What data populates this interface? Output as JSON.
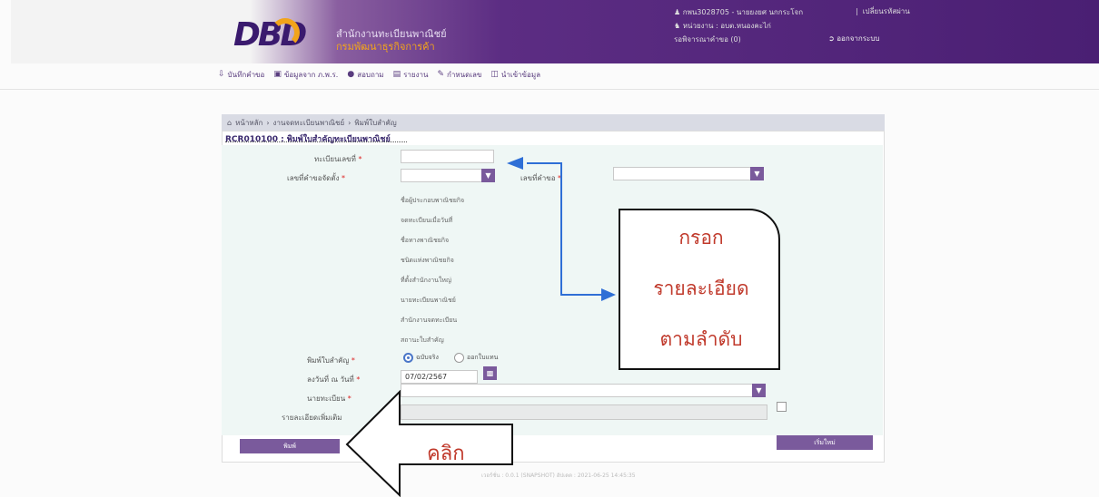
{
  "header": {
    "logo_text": "DBD",
    "dept_line1": "สำนักงานทะเบียนพาณิชย์",
    "dept_line2": "กรมพัฒนาธุรกิจการค้า",
    "user_line": "กพน3028705 - นายยงยศ นกกระโจก",
    "unit_line": "หน่วยงาน : อบต.หนองคะไก่",
    "pending_line": "รอพิจารณาคำขอ (0)",
    "change_password": "เปลี่ยนรหัสผ่าน",
    "separator": "|",
    "logout": "ออกจากระบบ"
  },
  "menu": {
    "items": [
      {
        "icon": "save-icon",
        "label": "บันทึกคำขอ"
      },
      {
        "icon": "monitor-icon",
        "label": "ข้อมูลจาก ภ.พ.ร."
      },
      {
        "icon": "chat-icon",
        "label": "สอบถาม"
      },
      {
        "icon": "report-icon",
        "label": "รายงาน"
      },
      {
        "icon": "edit-icon",
        "label": "กำหนดเลข"
      },
      {
        "icon": "import-icon",
        "label": "นำเข้าข้อมูล"
      }
    ]
  },
  "breadcrumb": {
    "home": "หน้าหลัก",
    "level2": "งานจดทะเบียนพาณิชย์",
    "level3": "พิมพ์ใบสำคัญ"
  },
  "form": {
    "title": "RCR010100 : พิมพ์ใบสำคัญทะเบียนพาณิชย์",
    "reg_no_label": "ทะเบียนเลขที่",
    "doc_no_label": "เลขที่คำขอจัดตั้ง",
    "request_no_label": "เลขที่คำขอ",
    "required_mark": "*",
    "static_fields": [
      "ชื่อผู้ประกอบพาณิชยกิจ",
      "จดทะเบียนเมื่อวันที่",
      "ชื่อทางพาณิชยกิจ",
      "ชนิดแห่งพาณิชยกิจ",
      "ที่ตั้งสำนักงานใหญ่",
      "นายทะเบียนพาณิชย์",
      "สำนักงานจดทะเบียน",
      "สถานะใบสำคัญ"
    ],
    "print_type_label": "พิมพ์ใบสำคัญ",
    "radio_original": "ฉบับจริง",
    "radio_copy": "ออกใบแทน",
    "date_label": "ลงวันที่ ณ วันที่",
    "date_value": "07/02/2567",
    "registrar_label": "นายทะเบียน",
    "extra_label": "รายละเอียดเพิ่มเติม",
    "print_button": "พิมพ์",
    "new_button": "เริ่มใหม่"
  },
  "footer": {
    "version": "เวอร์ชั่น : 0.0.1 (SNAPSHOT) อัปเดต : 2021-06-25 14:45:35"
  },
  "annotations": {
    "callout_lines": [
      "กรอก",
      "รายละเอียด",
      "ตามลำดับ"
    ],
    "click_label": "คลิก",
    "colors": {
      "annotation_text": "#c0392b",
      "arrow_blue": "#2f6fd6"
    }
  }
}
